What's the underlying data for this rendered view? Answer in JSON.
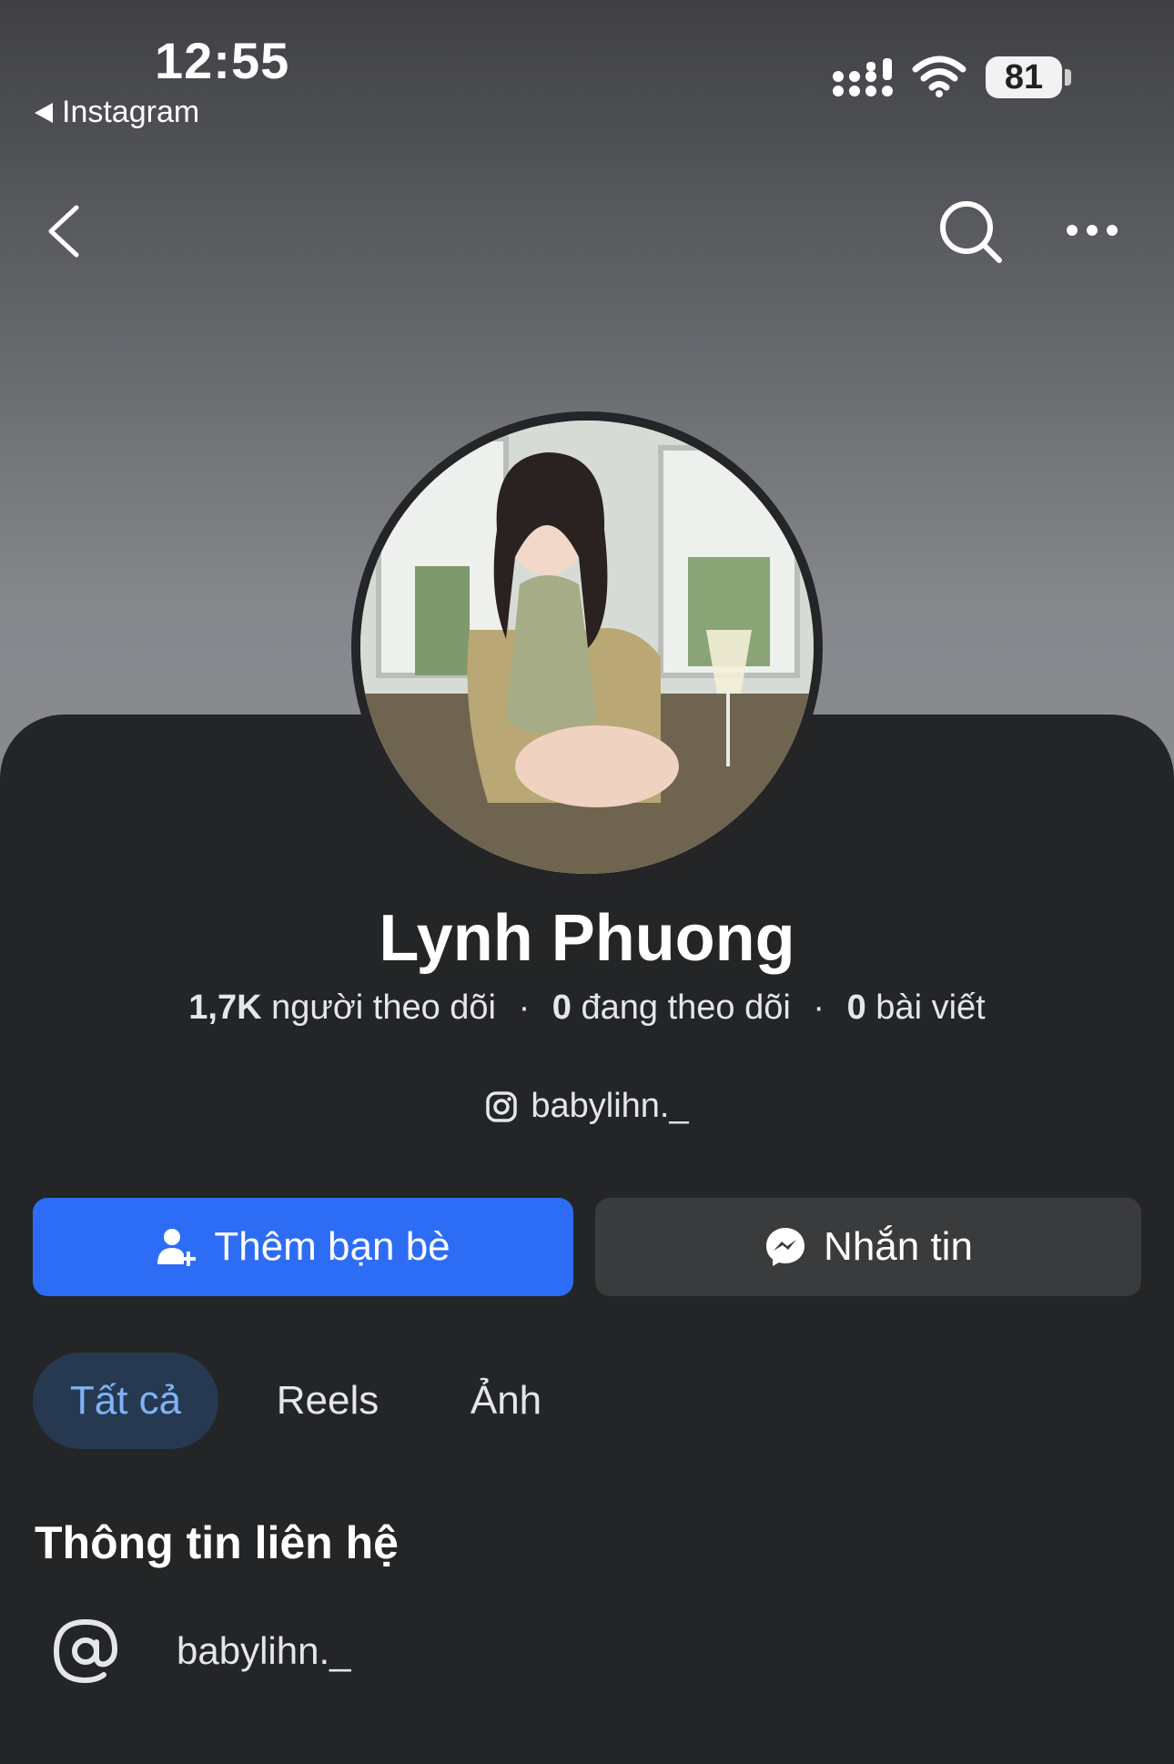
{
  "status_bar": {
    "time": "12:55",
    "back_app": "Instagram",
    "battery": "81"
  },
  "profile": {
    "name": "Lynh Phuong",
    "followers": "1,7K",
    "followers_label": "người theo dõi",
    "following": "0",
    "following_label": "đang theo dõi",
    "posts": "0",
    "posts_label": "bài viết",
    "instagram_handle": "babylihn._"
  },
  "actions": {
    "add_friend": "Thêm bạn bè",
    "message": "Nhắn tin"
  },
  "tabs": [
    {
      "label": "Tất cả",
      "active": true
    },
    {
      "label": "Reels",
      "active": false
    },
    {
      "label": "Ảnh",
      "active": false
    }
  ],
  "contact": {
    "title": "Thông tin liên hệ",
    "items": [
      {
        "icon": "at-icon",
        "value": "babylihn._"
      }
    ]
  },
  "colors": {
    "primary_button": "#2d6df6",
    "secondary_button": "#3a3b3c",
    "active_tab_bg": "#263951",
    "active_tab_text": "#7fb2f5",
    "background": "#242526"
  }
}
